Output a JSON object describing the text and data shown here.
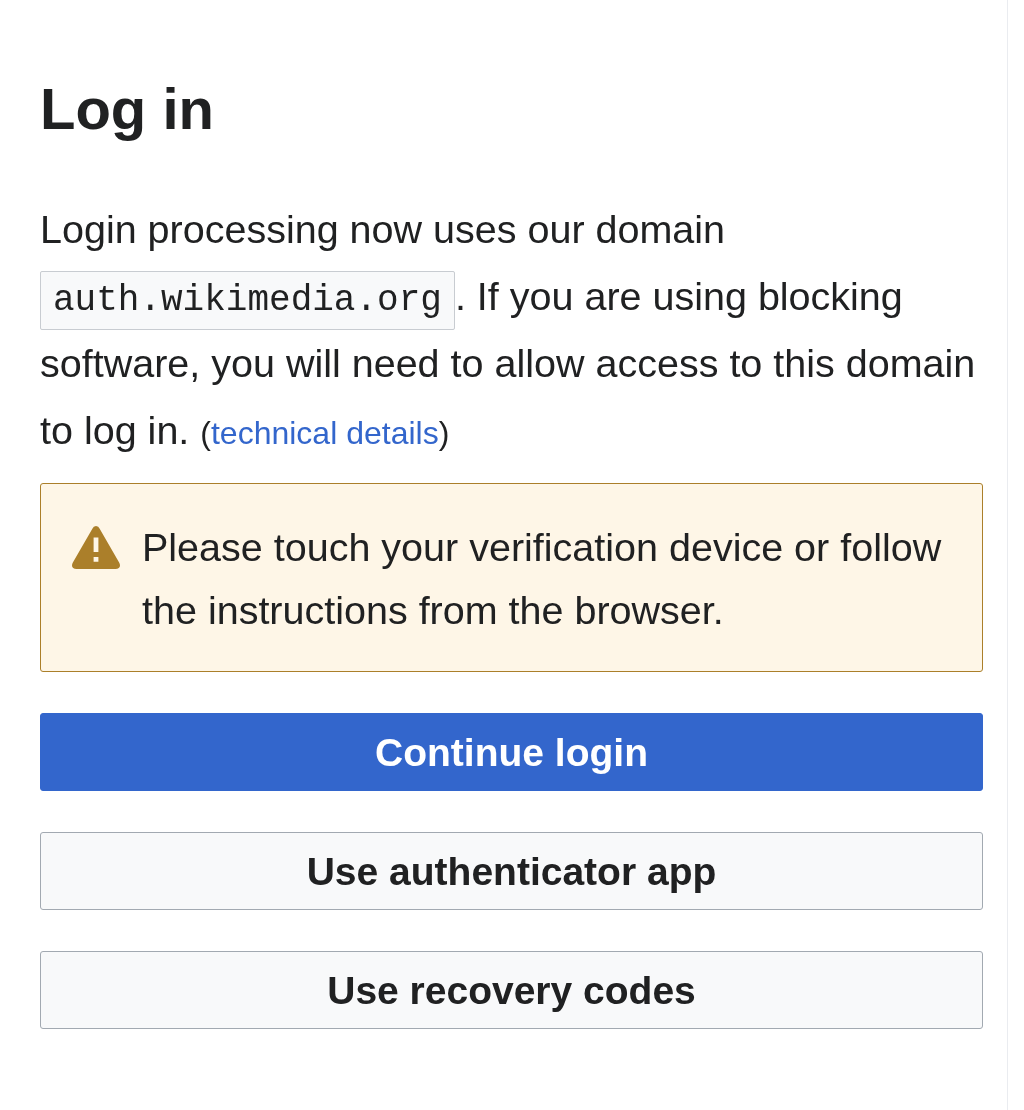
{
  "heading": "Log in",
  "intro": {
    "parts": [
      {
        "kind": "text",
        "text": "Login processing now uses our domain "
      },
      {
        "kind": "code",
        "text": "auth.wikimedia.org"
      },
      {
        "kind": "text",
        "text": ". If you are using blocking software, you will need to allow access to this domain to log in. "
      },
      {
        "kind": "small",
        "text": "("
      },
      {
        "kind": "link",
        "text": "technical details"
      },
      {
        "kind": "small",
        "text": ")"
      }
    ]
  },
  "message": {
    "kind": "warning",
    "text": "Please touch your verification device or follow the instructions from the browser."
  },
  "buttons": [
    {
      "label": "Continue login",
      "kind": "primary"
    },
    {
      "label": "Use authenticator app",
      "kind": "normal"
    },
    {
      "label": "Use recovery codes",
      "kind": "normal"
    }
  ]
}
